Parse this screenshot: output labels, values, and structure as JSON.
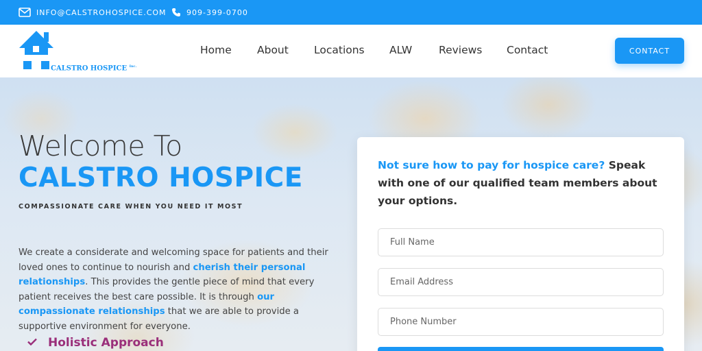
{
  "topbar": {
    "email": "INFO@CALSTROHOSPICE.COM",
    "phone": "909-399-0700",
    "email_icon": "envelope-icon",
    "phone_icon": "phone-icon"
  },
  "header": {
    "logo_text": "CALSTRO HOSPICE",
    "logo_suffix": "Inc.",
    "nav": [
      "Home",
      "About",
      "Locations",
      "ALW",
      "Reviews",
      "Contact"
    ],
    "contact_button": "CONTACT"
  },
  "hero": {
    "welcome": "Welcome To",
    "brand": "CALSTRO HOSPICE",
    "tagline": "COMPASSIONATE CARE WHEN YOU NEED IT MOST",
    "paragraph": {
      "p1": "We create a considerate and welcoming space for patients and their loved ones to continue to nourish and ",
      "h1": "cherish their personal relationships",
      "p2": ". This provides the gentle piece of mind that every patient receives the best care possible. It is through ",
      "h2": "our compassionate relationships",
      "p3": " that we are able to provide a supportive environment for everyone."
    },
    "feature": "Holistic Approach"
  },
  "form": {
    "question_highlight": "Not sure how to pay for hospice care?",
    "question_rest": " Speak with one of our qualified team members about your options.",
    "full_name_placeholder": "Full Name",
    "email_placeholder": "Email Address",
    "phone_placeholder": "Phone Number"
  },
  "colors": {
    "accent": "#1a97f5",
    "feature": "#9a2f7a"
  }
}
